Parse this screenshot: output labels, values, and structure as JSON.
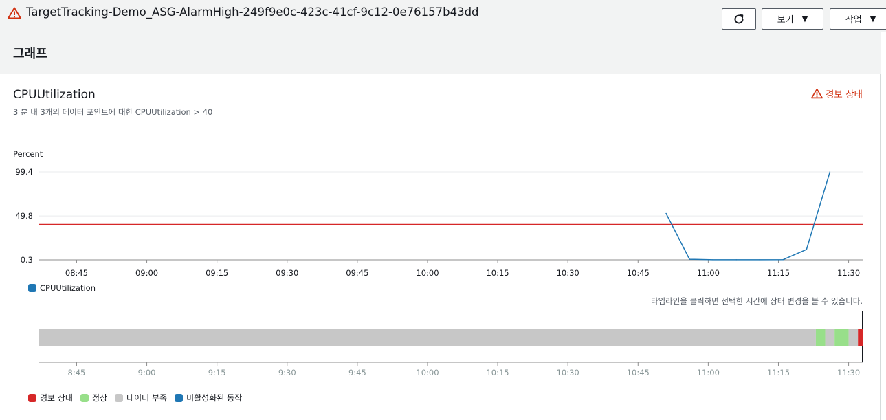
{
  "header": {
    "alarm_name": "TargetTracking-Demo_ASG-AlarmHigh-249f9e0c-423c-41cf-9c12-0e76157b43dd",
    "view_label": "보기",
    "actions_label": "작업"
  },
  "panel": {
    "title": "그래프",
    "metric_name": "CPUUtilization",
    "condition": "3 분 내 3개의 데이터 포인트에 대한 CPUUtilization > 40",
    "state_label": "경보 상태"
  },
  "colors": {
    "series": "#1f77b4",
    "threshold": "#d62728",
    "alarm": "#d62728",
    "ok": "#98df8a",
    "insufficient": "#c7c7c7",
    "disabled": "#1f77b4",
    "warning": "#d13212"
  },
  "chart_data": {
    "type": "line",
    "ylabel": "Percent",
    "y_ticks": [
      "99.4",
      "49.8",
      "0.3"
    ],
    "ylim": [
      0.3,
      99.4
    ],
    "x_ticks": [
      "08:45",
      "09:00",
      "09:15",
      "09:30",
      "09:45",
      "10:00",
      "10:15",
      "10:30",
      "10:45",
      "11:00",
      "11:15",
      "11:30"
    ],
    "xlim": [
      "08:37",
      "11:33"
    ],
    "series": [
      {
        "name": "CPUUtilization",
        "x": [
          "10:51",
          "10:56",
          "11:01",
          "11:06",
          "11:11",
          "11:16",
          "11:21",
          "11:26"
        ],
        "values": [
          52.5,
          1.0,
          0.4,
          0.4,
          0.4,
          0.5,
          12.0,
          99.4
        ]
      }
    ],
    "threshold": 40,
    "grid": true,
    "legend": "bottom-left"
  },
  "timeline": {
    "hint": "타임라인을 클릭하면 선택한 시간에 상태 변경을 볼 수 있습니다.",
    "x_ticks": [
      "8:45",
      "9:00",
      "9:15",
      "9:30",
      "9:45",
      "10:00",
      "10:15",
      "10:30",
      "10:45",
      "11:00",
      "11:15",
      "11:30"
    ],
    "segments": [
      {
        "state": "insufficient",
        "from": "08:37",
        "to": "11:23"
      },
      {
        "state": "ok",
        "from": "11:23",
        "to": "11:25"
      },
      {
        "state": "insufficient",
        "from": "11:25",
        "to": "11:27"
      },
      {
        "state": "ok",
        "from": "11:27",
        "to": "11:30"
      },
      {
        "state": "insufficient",
        "from": "11:30",
        "to": "11:32"
      },
      {
        "state": "alarm",
        "from": "11:32",
        "to": "11:33"
      }
    ],
    "legend": [
      {
        "key": "alarm",
        "label": "경보 상태"
      },
      {
        "key": "ok",
        "label": "정상"
      },
      {
        "key": "insufficient",
        "label": "데이터 부족"
      },
      {
        "key": "disabled",
        "label": "비활성화된 동작"
      }
    ]
  }
}
